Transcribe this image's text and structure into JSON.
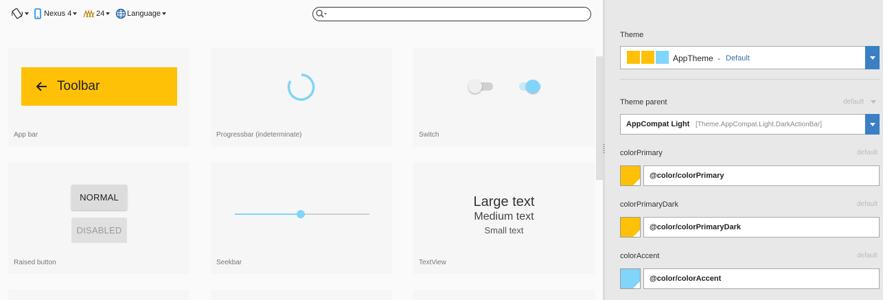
{
  "toolbar": {
    "device": "Nexus 4",
    "api_level": "24",
    "language": "Language",
    "search_placeholder": ""
  },
  "cards": {
    "app_bar": {
      "label": "App bar",
      "toolbar_title": "Toolbar"
    },
    "progressbar": {
      "label": "Progressbar (indeterminate)"
    },
    "switch": {
      "label": "Switch"
    },
    "raised_button": {
      "label": "Raised button",
      "normal": "NORMAL",
      "disabled": "DISABLED"
    },
    "seekbar": {
      "label": "Seekbar",
      "progress": 0.49
    },
    "textview": {
      "label": "TextView",
      "large": "Large text",
      "medium": "Medium text",
      "small": "Small text"
    }
  },
  "panel": {
    "theme_label": "Theme",
    "theme_name": "AppTheme",
    "theme_sep": "-",
    "theme_state": "Default",
    "theme_swatches": [
      "#ffc107",
      "#ffc107",
      "#81d4fa"
    ],
    "parent_label": "Theme parent",
    "parent_default": "default",
    "parent_name": "AppCompat Light",
    "parent_qualified": "[Theme.AppCompat.Light.DarkActionBar]",
    "attributes": [
      {
        "name": "colorPrimary",
        "default": "default",
        "value": "@color/colorPrimary",
        "color": "#ffc107"
      },
      {
        "name": "colorPrimaryDark",
        "default": "default",
        "value": "@color/colorPrimaryDark",
        "color": "#ffc107"
      },
      {
        "name": "colorAccent",
        "default": "default",
        "value": "@color/colorAccent",
        "color": "#81d4fa"
      }
    ]
  },
  "colors": {
    "accent": "#81d4fa",
    "primary": "#ffc107",
    "link_blue": "#3b7fc4"
  }
}
